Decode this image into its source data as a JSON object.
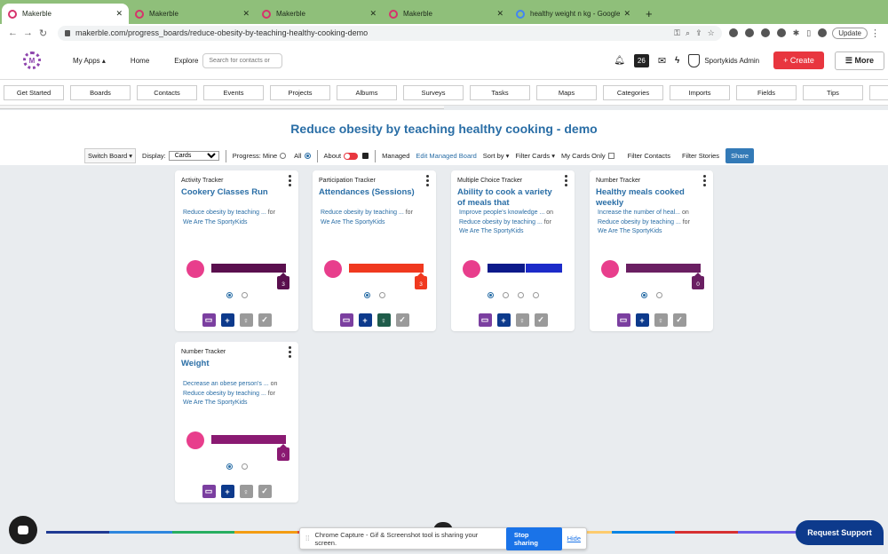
{
  "browser": {
    "tabs": [
      {
        "title": "Makerble",
        "active": true
      },
      {
        "title": "Makerble",
        "active": false
      },
      {
        "title": "Makerble",
        "active": false
      },
      {
        "title": "Makerble",
        "active": false
      },
      {
        "title": "healthy weight n kg - Google S",
        "active": false
      }
    ],
    "url": "makerble.com/progress_boards/reduce-obesity-by-teaching-healthy-cooking-demo",
    "update_label": "Update"
  },
  "header": {
    "logo_letter": "M",
    "my_apps": "My Apps ▴",
    "home": "Home",
    "explore": "Explore",
    "search_placeholder": "Search for contacts or",
    "notifications_count": "26",
    "account_name": "Sportykids Admin",
    "create_label": "+ Create",
    "more_label": "☰ More"
  },
  "subnav": [
    "Get Started",
    "Boards",
    "Contacts",
    "Events",
    "Projects",
    "Albums",
    "Surveys",
    "Tasks",
    "Maps",
    "Categories",
    "Imports",
    "Fields",
    "Tips",
    "S"
  ],
  "board": {
    "title": "Reduce obesity by teaching healthy cooking - demo"
  },
  "controls": {
    "switch_board": "Switch Board ▾",
    "display_label": "Display:",
    "display_value": "Cards",
    "progress_label": "Progress: Mine",
    "progress_all": "All",
    "about": "About",
    "managed": "Managed",
    "edit_managed": "Edit Managed Board",
    "sort_by": "Sort by ▾",
    "filter_cards": "Filter Cards ▾",
    "my_cards_only": "My Cards Only",
    "filter_contacts": "Filter Contacts",
    "filter_stories": "Filter Stories",
    "share": "Share"
  },
  "cards": [
    {
      "type": "Activity Tracker",
      "title": "Cookery Classes Run",
      "desc": [
        [
          "Reduce obesity by teaching ...",
          " for"
        ],
        [
          "We Are The SportyKids",
          ""
        ]
      ],
      "bar_colors": [
        "#5a0f4e"
      ],
      "badge": "3",
      "badge_color": "#5a0f4e",
      "dots": 2,
      "active_dot": 0
    },
    {
      "type": "Participation Tracker",
      "title": "Attendances (Sessions)",
      "desc": [
        [
          "Reduce obesity by teaching ...",
          " for"
        ],
        [
          "We Are The SportyKids",
          ""
        ]
      ],
      "bar_colors": [
        "#f0391f"
      ],
      "badge": "3",
      "badge_color": "#f0391f",
      "dots": 2,
      "active_dot": 0
    },
    {
      "type": "Multiple Choice Tracker",
      "title": "Ability to cook a variety of meals that",
      "desc": [
        [
          "Improve people's knowledge ...",
          " on"
        ],
        [
          "Reduce obesity by teaching ...",
          " for"
        ],
        [
          "We Are The SportyKids",
          ""
        ]
      ],
      "bar_colors": [
        "#0c1a8a",
        "#1c2bc9"
      ],
      "badge": "",
      "badge_color": "",
      "dots": 4,
      "active_dot": 0
    },
    {
      "type": "Number Tracker",
      "title": "Healthy meals cooked weekly",
      "desc": [
        [
          "Increase the number of heal...",
          " on"
        ],
        [
          "Reduce obesity by teaching ...",
          " for"
        ],
        [
          "We Are The SportyKids",
          ""
        ]
      ],
      "bar_colors": [
        "#6a1f62"
      ],
      "badge": "0",
      "badge_color": "#6a1f62",
      "dots": 2,
      "active_dot": 0
    },
    {
      "type": "Number Tracker",
      "title": "Weight",
      "desc": [
        [
          "Decrease an obese person's ...",
          " on"
        ],
        [
          "Reduce obesity by teaching ...",
          " for"
        ],
        [
          "We Are The SportyKids",
          ""
        ]
      ],
      "bar_colors": [
        "#8a1a72"
      ],
      "badge": "0",
      "badge_color": "#8a1a72",
      "dots": 2,
      "active_dot": 0
    }
  ],
  "footer": {
    "capture_text": "Chrome Capture - Gif & Screenshot tool is sharing your screen.",
    "stop_sharing": "Stop sharing",
    "hide": "Hide",
    "request_support": "Request Support"
  },
  "colors": {
    "accent": "#2a6ea6",
    "create": "#e8363f",
    "avatar": "#e83e8c",
    "support": "#0d3a8c"
  },
  "icons": [
    "chat-icon",
    "plus-icon",
    "lightbulb-icon",
    "checkbox-icon",
    "kebab-icon",
    "bell-icon",
    "mail-icon",
    "bolt-icon",
    "shield-icon",
    "lock-icon"
  ]
}
